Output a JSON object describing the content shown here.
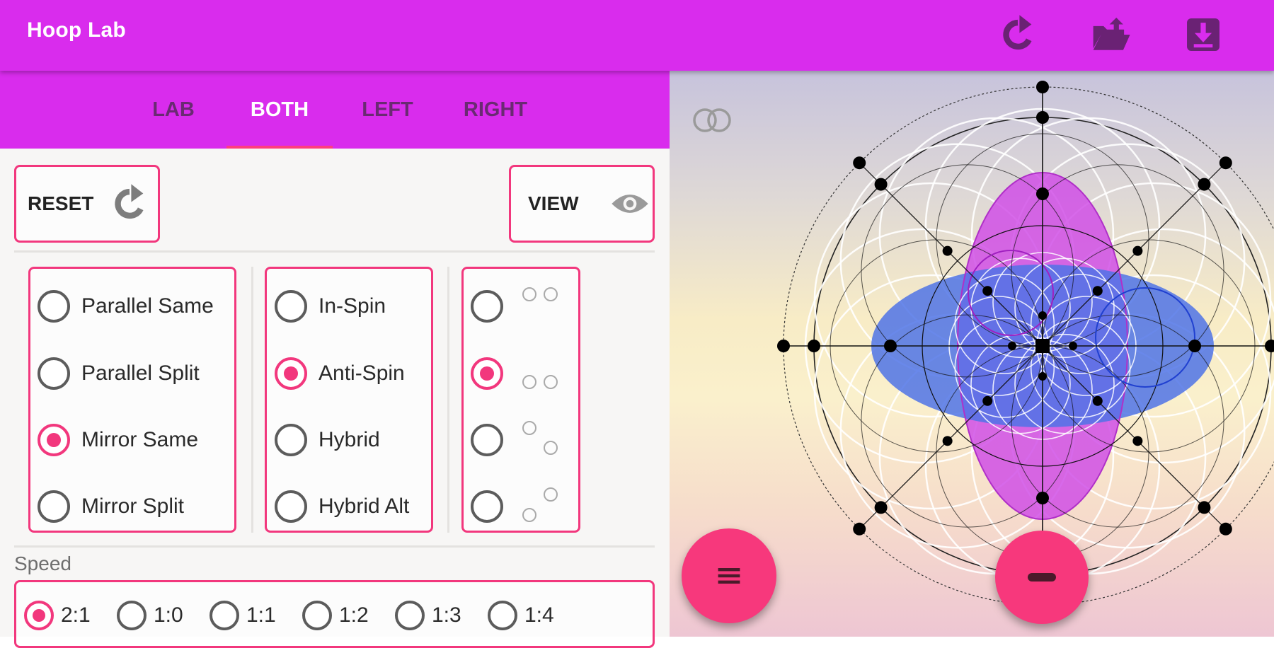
{
  "app": {
    "title": "Hoop Lab"
  },
  "toolbar": {
    "refresh_icon": "refresh-icon",
    "open_icon": "folder-open-icon",
    "download_icon": "download-icon"
  },
  "tabs": [
    {
      "label": "LAB",
      "active": false
    },
    {
      "label": "BOTH",
      "active": true
    },
    {
      "label": "LEFT",
      "active": false
    },
    {
      "label": "RIGHT",
      "active": false
    }
  ],
  "controls": {
    "reset_label": "RESET",
    "view_label": "VIEW"
  },
  "pattern_group": {
    "options": [
      "Parallel Same",
      "Parallel Split",
      "Mirror Same",
      "Mirror Split"
    ],
    "selected": "Mirror Same"
  },
  "spin_group": {
    "options": [
      "In-Spin",
      "Anti-Spin",
      "Hybrid",
      "Hybrid Alt"
    ],
    "selected": "Anti-Spin"
  },
  "position_group": {
    "options": [
      "hoops-side-by-side-top",
      "hoops-side-by-side-bottom",
      "hoops-diagonal",
      "hoops-diagonal-reversed"
    ],
    "selected_index": 1
  },
  "speed": {
    "label": "Speed",
    "options": [
      "2:1",
      "1:0",
      "1:1",
      "1:2",
      "1:3",
      "1:4"
    ],
    "selected": "2:1"
  },
  "colors": {
    "primary": "#d92ced",
    "accent": "#f2377d",
    "petal_vertical": "#d04fe6",
    "petal_horizontal": "#4f73e6"
  }
}
